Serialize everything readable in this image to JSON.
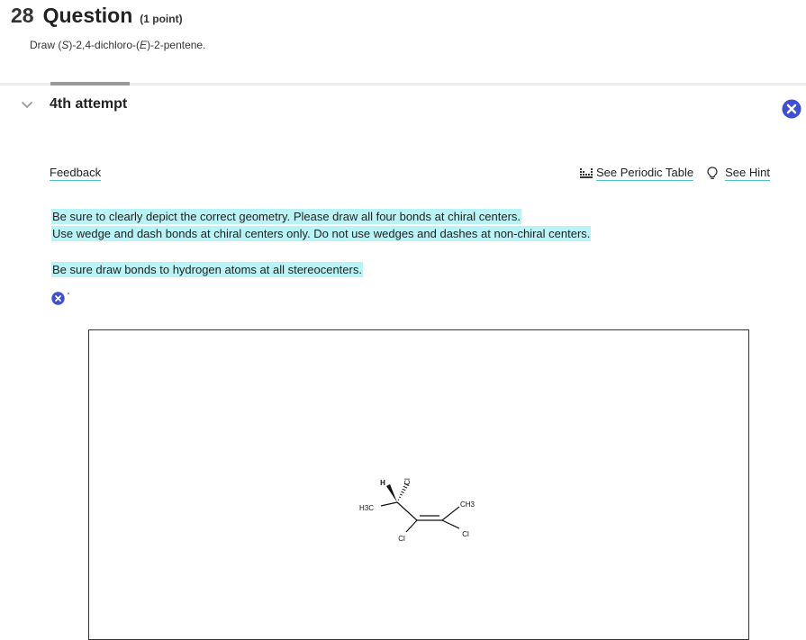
{
  "question": {
    "number": "28",
    "word": "Question",
    "points": "(1 point)",
    "prompt_pre": "Draw (",
    "prompt_s": "S",
    "prompt_mid": ")-2,4-dichloro-(",
    "prompt_e": "E",
    "prompt_post": ")-2-pentene."
  },
  "attempt": {
    "label": "4th attempt"
  },
  "feedback": {
    "link_label": "Feedback",
    "lines": [
      "Be sure to clearly depict the correct geometry.  Please draw all four bonds at chiral centers.",
      "Use wedge and dash bonds at chiral centers only. Do not use wedges and dashes at non-chiral centers.",
      "Be sure draw bonds to hydrogen atoms at all stereocenters."
    ],
    "result_mark": "'"
  },
  "tools": {
    "periodic_table": "See Periodic Table",
    "hint": "See Hint"
  },
  "molecule": {
    "labels": {
      "h": "H",
      "cl_top": "Cl",
      "h3c": "H3C",
      "ch3": "CH3",
      "cl_left": "Cl",
      "cl_right": "Cl"
    }
  },
  "colors": {
    "accent": "#3d4fd6",
    "highlight": "#b9f3f5",
    "link_underline": "#4fc3c7"
  },
  "icons": {
    "collapse": "chevron-down-icon",
    "close": "close-icon",
    "periodic_table": "periodic-table-icon",
    "hint": "lightbulb-icon",
    "incorrect": "incorrect-x-icon"
  }
}
